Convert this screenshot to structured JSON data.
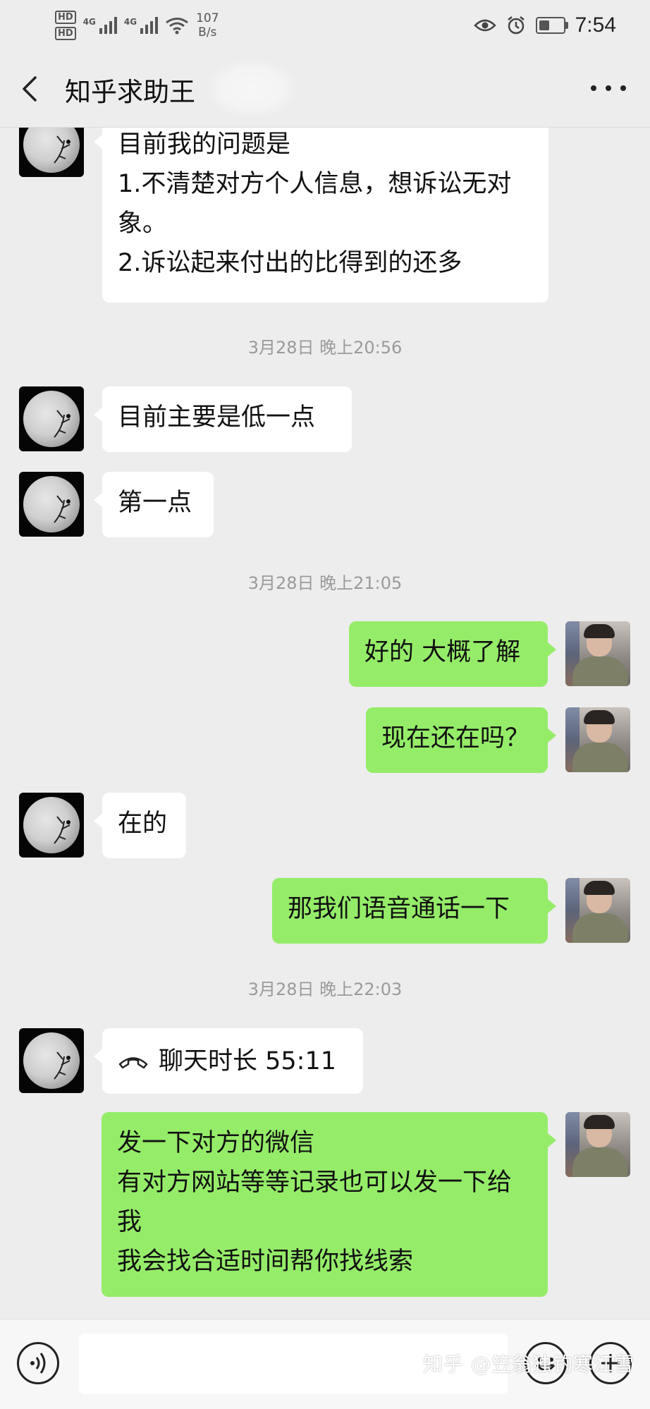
{
  "status_bar": {
    "hd1": "HD",
    "hd2": "HD",
    "net1": "4G",
    "net2": "4G",
    "speed_value": "107",
    "speed_unit": "B/s",
    "time": "7:54",
    "battery_level": 0.45
  },
  "header": {
    "title": "知乎求助王"
  },
  "chat": {
    "msg1": "目前我的问题是\n1.不清楚对方个人信息，想诉讼无对象。\n2.诉讼起来付出的比得到的还多",
    "ts1": "3月28日 晚上20:56",
    "msg2": "目前主要是低一点",
    "msg3": "第一点",
    "ts2": "3月28日 晚上21:05",
    "msg4": "好的 大概了解",
    "msg5": "现在还在吗？",
    "msg6": "在的",
    "msg7": "那我们语音通话一下",
    "ts3": "3月28日 晚上22:03",
    "call_label": "聊天时长 55:11",
    "msg8": "发一下对方的微信\n有对方网站等等记录也可以发一下给我\n我会找合适时间帮你找线索"
  },
  "watermark": "知乎 @笠翁独钓寒江雪",
  "colors": {
    "outgoing_bubble": "#95ec69",
    "incoming_bubble": "#ffffff",
    "background": "#ededed"
  }
}
